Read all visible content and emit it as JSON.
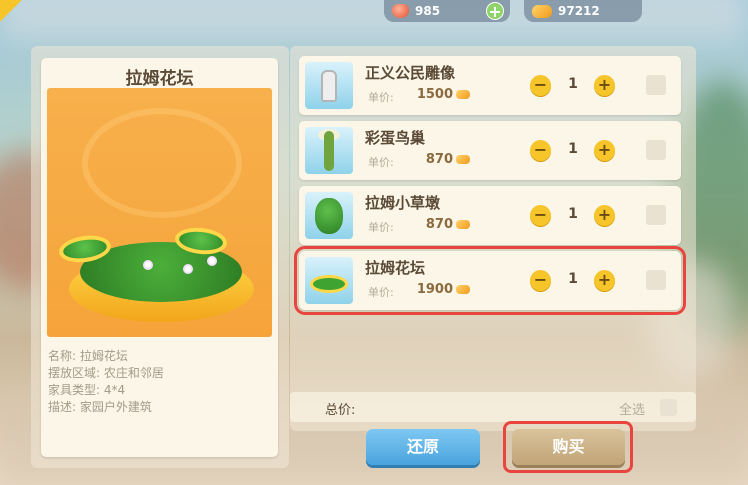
{
  "currency": {
    "gems": "985",
    "coins": "97212"
  },
  "detail": {
    "title": "拉姆花坛",
    "info": [
      {
        "label": "名称:",
        "value": "拉姆花坛"
      },
      {
        "label": "摆放区域:",
        "value": "农庄和邻居"
      },
      {
        "label": "家具类型:",
        "value": "4*4"
      },
      {
        "label": "描述:",
        "value": "家园户外建筑"
      }
    ]
  },
  "items": [
    {
      "name": "正义公民雕像",
      "price_label": "单价:",
      "price": "1500",
      "qty": "1",
      "icon": "statue-icon"
    },
    {
      "name": "彩蛋鸟巢",
      "price_label": "单价:",
      "price": "870",
      "qty": "1",
      "icon": "egg-nest-icon"
    },
    {
      "name": "拉姆小草墩",
      "price_label": "单价:",
      "price": "870",
      "qty": "1",
      "icon": "grass-stool-icon"
    },
    {
      "name": "拉姆花坛",
      "price_label": "单价:",
      "price": "1900",
      "qty": "1",
      "icon": "flower-bed-icon",
      "selected": true
    }
  ],
  "summary": {
    "total_label": "总价:",
    "select_all_label": "全选"
  },
  "buttons": {
    "reset": "还原",
    "buy": "购买"
  },
  "qty_controls": {
    "minus": "−",
    "plus": "+"
  },
  "colors": {
    "accent_highlight": "#e9453f",
    "qty_button": "#f6c52a",
    "reset_button": "#4aa3dd",
    "buy_button": "#c2a578"
  }
}
